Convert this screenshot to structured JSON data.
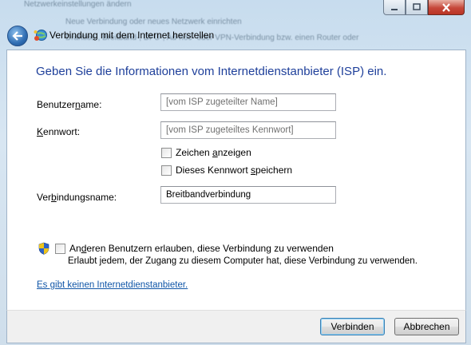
{
  "background_text": {
    "line1": "Netzwerkeinstellungen ändern",
    "line2": "Neue Verbindung oder neues Netzwerk einrichten",
    "line3": "Drahtlos-, Breitband-, DFÜ-, Ad-hoc- oder VPN-Verbindung bzw. einen Router oder"
  },
  "window": {
    "min": "–",
    "max": "□",
    "close": "✕"
  },
  "nav": {
    "title": "Verbindung mit dem Internet herstellen"
  },
  "heading": "Geben Sie die Informationen vom Internetdienstanbieter (ISP) ein.",
  "fields": {
    "username": {
      "label_pre": "Benutzer",
      "label_acc": "n",
      "label_post": "ame:",
      "value": "",
      "placeholder": "[vom ISP zugeteilter Name]"
    },
    "password": {
      "label_pre": "",
      "label_acc": "K",
      "label_post": "ennwort:",
      "value": "",
      "placeholder": "[vom ISP zugeteiltes Kennwort]"
    },
    "connection": {
      "label_pre": "Ver",
      "label_acc": "b",
      "label_post": "indungsname:",
      "value": "Breitbandverbindung",
      "placeholder": ""
    }
  },
  "checkboxes": {
    "show_chars": {
      "pre": "Zeichen ",
      "acc": "a",
      "post": "nzeigen",
      "checked": false
    },
    "save_pw": {
      "pre": "Dieses Kennwort ",
      "acc": "s",
      "post": "peichern",
      "checked": false
    },
    "allow_others": {
      "pre": "An",
      "acc": "d",
      "post": "eren Benutzern erlauben, diese Verbindung zu verwenden",
      "checked": false
    }
  },
  "allow_description": "Erlaubt jedem, der Zugang zu diesem Computer hat, diese Verbindung zu verwenden.",
  "link": "Es gibt keinen Internetdienstanbieter.",
  "buttons": {
    "connect": "Verbinden",
    "cancel": "Abbrechen"
  }
}
